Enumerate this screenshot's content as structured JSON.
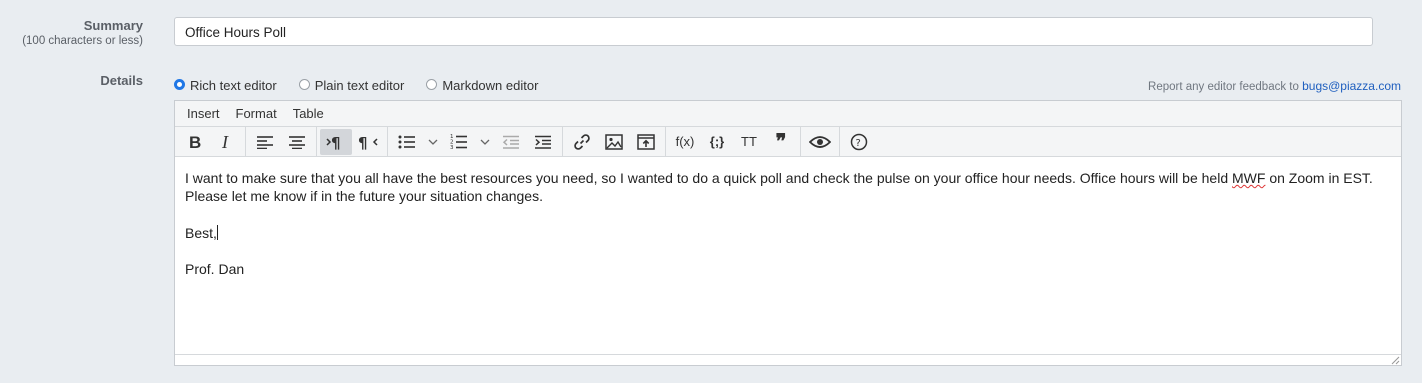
{
  "summary": {
    "label": "Summary",
    "sublabel": "(100 characters or less)",
    "value": "Office Hours Poll"
  },
  "details": {
    "label": "Details"
  },
  "editor_modes": [
    {
      "label": "Rich text editor",
      "selected": true
    },
    {
      "label": "Plain text editor",
      "selected": false
    },
    {
      "label": "Markdown editor",
      "selected": false
    }
  ],
  "feedback": {
    "text": "Report any editor feedback to",
    "link": "bugs@piazza.com"
  },
  "menubar": [
    "Insert",
    "Format",
    "Table"
  ],
  "toolbar": {
    "function_label": "f(x)",
    "code_label": "{;}",
    "tt_label": "TT",
    "quote_label": "❞",
    "active_button": "ltr-paragraph"
  },
  "content": {
    "paragraph1_before": "I want to make sure that you all have the best resources you need, so I wanted to do a quick poll and check the pulse on your office hour needs. Office hours will be held ",
    "paragraph1_misspelled": "MWF",
    "paragraph1_after": " on Zoom in EST. Please let me know if in the future your situation changes.",
    "paragraph2": "Best,",
    "paragraph3": "Prof. Dan"
  },
  "colors": {
    "accent": "#1f77e6",
    "link": "#1f5fbf",
    "background": "#e9edf1"
  }
}
